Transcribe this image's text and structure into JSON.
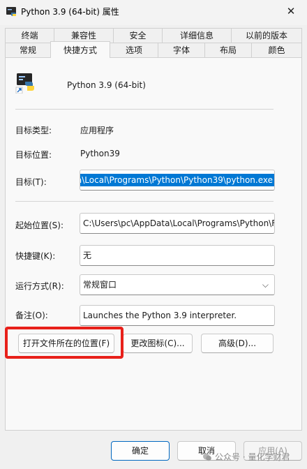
{
  "window": {
    "title": "Python 3.9 (64-bit) 属性",
    "close_glyph": "✕"
  },
  "tabs": {
    "back_row": [
      {
        "label": "终端"
      },
      {
        "label": "兼容性"
      },
      {
        "label": "安全"
      },
      {
        "label": "详细信息"
      },
      {
        "label": "以前的版本"
      }
    ],
    "front_row": [
      {
        "label": "常规"
      },
      {
        "label": "快捷方式",
        "active": true
      },
      {
        "label": "选项"
      },
      {
        "label": "字体"
      },
      {
        "label": "布局"
      },
      {
        "label": "颜色"
      }
    ]
  },
  "shortcut": {
    "icon": "python-shortcut-icon",
    "name": "Python 3.9 (64-bit)"
  },
  "fields": {
    "target_type": {
      "label": "目标类型:",
      "value": "应用程序"
    },
    "target_location": {
      "label": "目标位置:",
      "value": "Python39"
    },
    "target": {
      "label": "目标(T):",
      "value": "a\\Local\\Programs\\Python\\Python39\\python.exe"
    },
    "start_in": {
      "label": "起始位置(S):",
      "value": "C:\\Users\\pc\\AppData\\Local\\Programs\\Python\\F"
    },
    "hotkey": {
      "label": "快捷键(K):",
      "value": "无"
    },
    "run": {
      "label": "运行方式(R):",
      "value": "常规窗口",
      "chevron": "⌵"
    },
    "comment": {
      "label": "备注(O):",
      "value": "Launches the Python 3.9 interpreter."
    }
  },
  "buttons": {
    "open_location": "打开文件所在的位置(F)",
    "change_icon": "更改图标(C)...",
    "advanced": "高级(D)...",
    "ok": "确定",
    "cancel": "取消",
    "apply": "应用(A)"
  },
  "watermark": {
    "text": "公众号 · 量化学财君"
  },
  "colors": {
    "accent": "#0078d4",
    "highlight_box": "#e8201a",
    "panel": "#f9f9f9"
  }
}
